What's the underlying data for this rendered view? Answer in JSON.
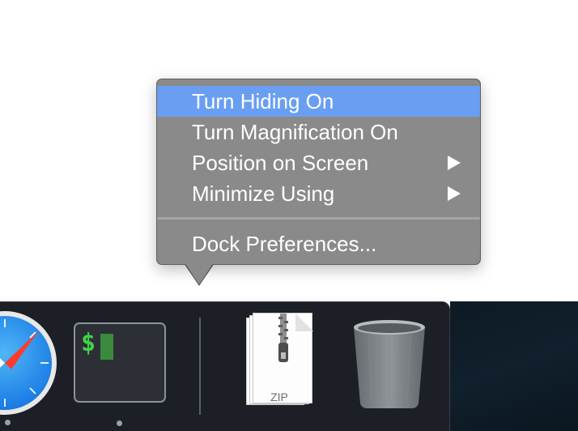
{
  "context_menu": {
    "items": [
      {
        "label": "Turn Hiding On",
        "highlighted": true,
        "has_submenu": false
      },
      {
        "label": "Turn Magnification On",
        "highlighted": false,
        "has_submenu": false
      },
      {
        "label": "Position on Screen",
        "highlighted": false,
        "has_submenu": true
      },
      {
        "label": "Minimize Using",
        "highlighted": false,
        "has_submenu": true
      }
    ],
    "footer_item": {
      "label": "Dock Preferences..."
    }
  },
  "dock": {
    "apps": [
      {
        "name": "Safari",
        "icon": "safari-compass-icon"
      },
      {
        "name": "Terminal",
        "icon": "terminal-icon",
        "prompt": "$"
      }
    ],
    "documents": [
      {
        "icon": "zip-archive-icon",
        "label": "ZIP"
      },
      {
        "icon": "trash-icon"
      }
    ]
  },
  "colors": {
    "menu_background": "#8a8a8a",
    "menu_highlight": "#6a9ef3",
    "dock_background": "#1c2026",
    "terminal_green": "#42d24a"
  }
}
